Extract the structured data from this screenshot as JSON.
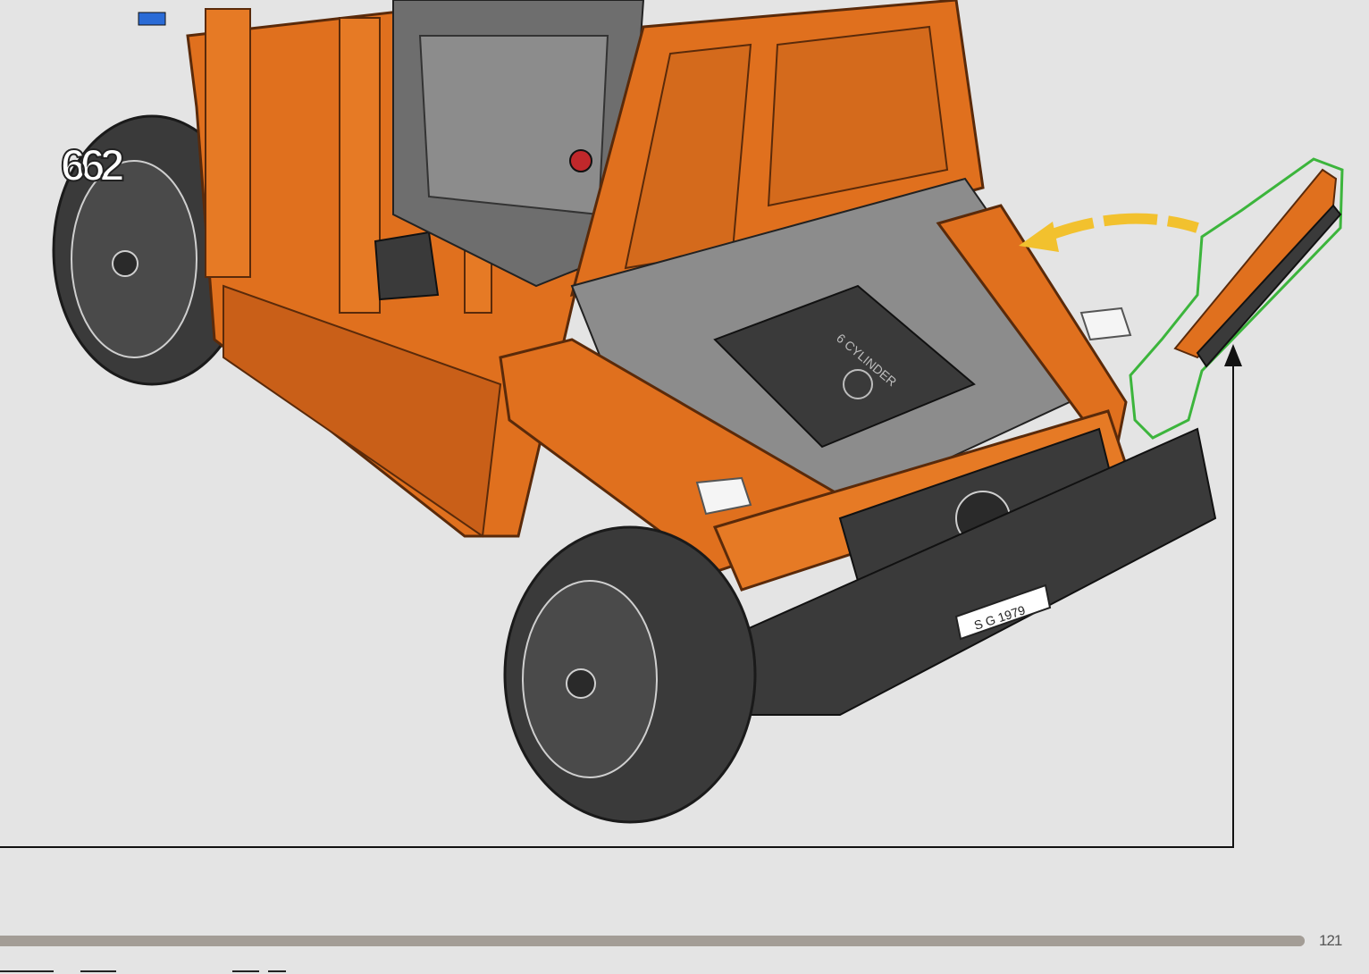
{
  "step": {
    "number": "662"
  },
  "page": {
    "number": "121"
  },
  "progress": {
    "fraction": 1.0
  },
  "model": {
    "name": "orange-offroad-vehicle-front",
    "license_plate": "S G 1979",
    "engine_label": "6 CYLINDER"
  },
  "icons": {
    "callout_arrow": "curved-placement-arrow",
    "pointer_arrow": "up-pointer-arrow"
  },
  "colors": {
    "background": "#e4e4e4",
    "body": "#e0701e",
    "body_dark": "#b8561a",
    "dark_parts": "#3a3a3a",
    "grey_parts": "#8c8c8c",
    "highlight": "#3cb53c",
    "callout_arrow": "#f2c12e",
    "progress": "#a39d96"
  }
}
